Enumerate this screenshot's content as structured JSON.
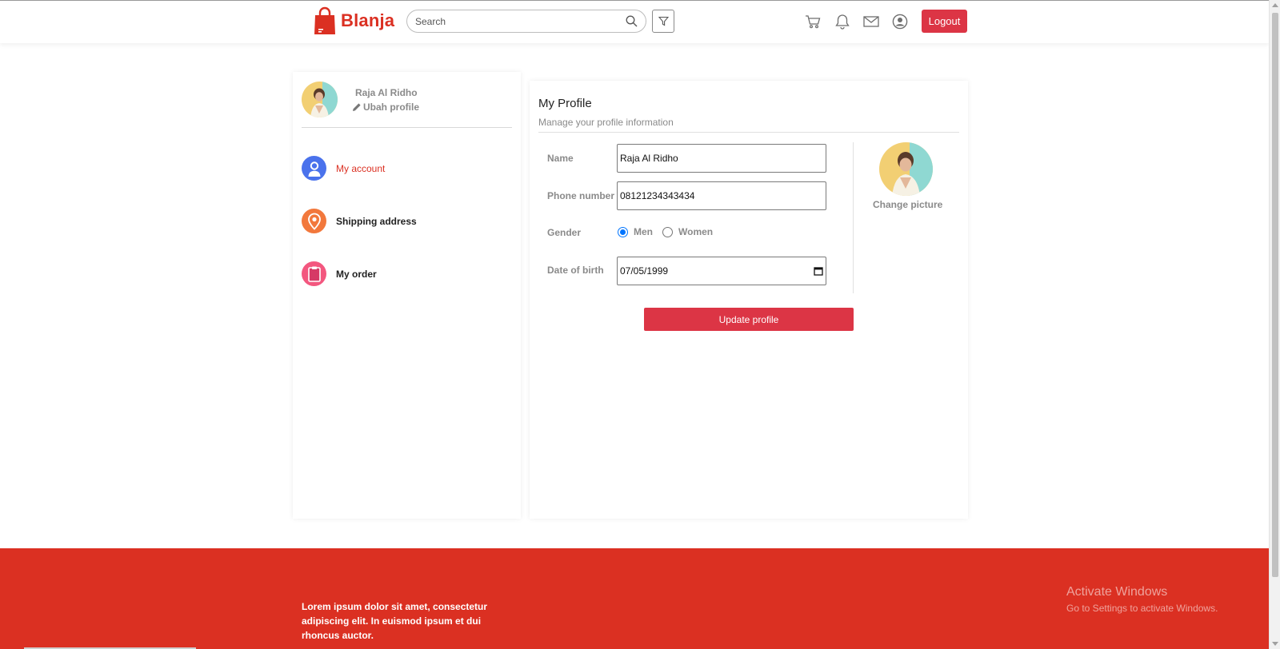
{
  "header": {
    "brand": "Blanja",
    "search_placeholder": "Search",
    "logout_label": "Logout",
    "icons": [
      "cart-icon",
      "bell-icon",
      "mail-icon",
      "user-circle-icon"
    ]
  },
  "sidebar": {
    "user_name": "Raja Al Ridho",
    "edit_label": "Ubah profile",
    "items": [
      {
        "label": "My account",
        "icon": "user-icon",
        "color": "#4a72ec",
        "active": true
      },
      {
        "label": "Shipping address",
        "icon": "location-pin-icon",
        "color": "#f2783c",
        "active": false
      },
      {
        "label": "My order",
        "icon": "clipboard-icon",
        "color": "#f3577f",
        "active": false
      }
    ]
  },
  "profile": {
    "title": "My Profile",
    "subtitle": "Manage your profile information",
    "name_label": "Name",
    "name_value": "Raja Al Ridho",
    "phone_label": "Phone number",
    "phone_value": "08121234343434",
    "gender_label": "Gender",
    "gender_options": [
      "Men",
      "Women"
    ],
    "gender_selected": "Men",
    "dob_label": "Date of birth",
    "dob_value": "07/05/1999",
    "change_picture_label": "Change picture",
    "update_button_label": "Update profile"
  },
  "footer": {
    "text": "Lorem ipsum dolor sit amet, consectetur adipiscing elit. In euismod ipsum et dui rhoncus auctor."
  },
  "watermark": {
    "title": "Activate Windows",
    "subtitle": "Go to Settings to activate Windows."
  },
  "colors": {
    "brand": "#db3022",
    "button": "#dc3545",
    "muted_text": "#8a8a8a"
  }
}
